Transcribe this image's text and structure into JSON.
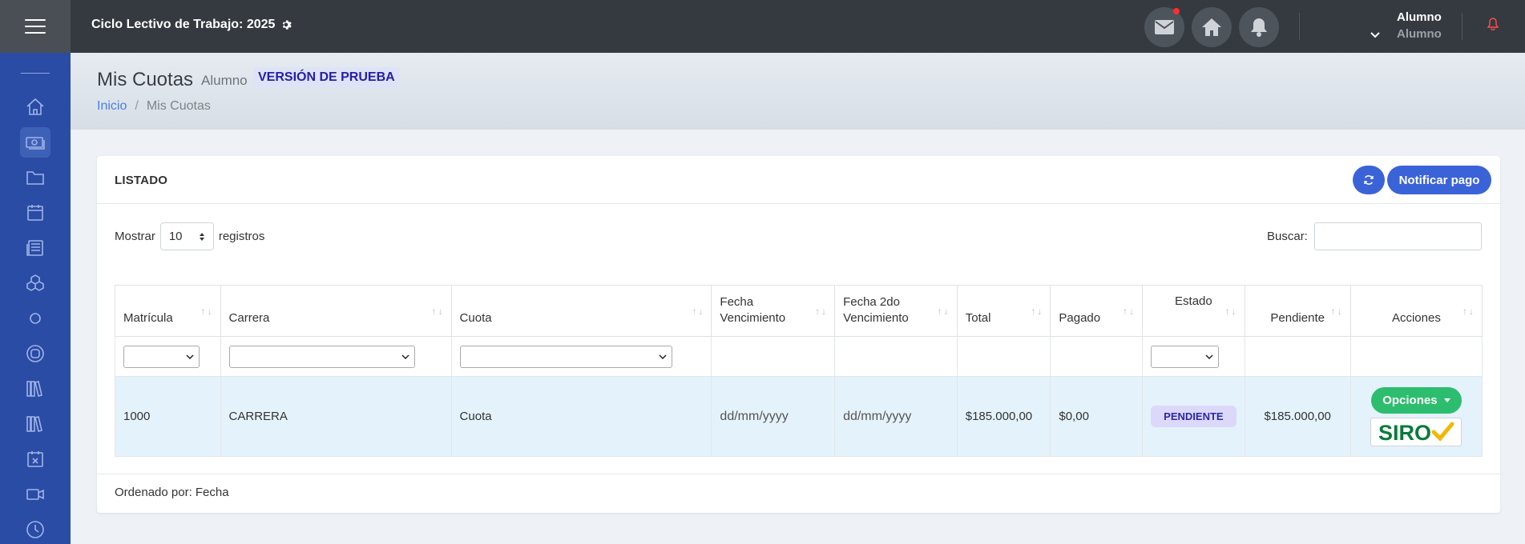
{
  "topbar": {
    "cycle_label": "Ciclo Lectivo de Trabajo: 2025",
    "user_name": "Alumno",
    "user_role": "Alumno"
  },
  "header": {
    "title": "Mis Cuotas",
    "subtitle": "Alumno",
    "trial_badge": "VERSIÓN DE PRUEBA",
    "breadcrumb_home": "Inicio",
    "breadcrumb_sep": "/",
    "breadcrumb_current": "Mis Cuotas"
  },
  "card": {
    "title": "LISTADO",
    "notify_button": "Notificar pago",
    "show_label": "Mostrar",
    "show_value": "10",
    "records_label": "registros",
    "search_label": "Buscar:",
    "search_value": "",
    "footer_note": "Ordenado por: Fecha"
  },
  "table": {
    "headers": {
      "matricula": "Matrícula",
      "carrera": "Carrera",
      "cuota": "Cuota",
      "fecha_venc_1": "Fecha",
      "fecha_venc_2": "Vencimiento",
      "fecha2_1": "Fecha 2do",
      "fecha2_2": "Vencimiento",
      "total": "Total",
      "pagado": "Pagado",
      "estado": "Estado",
      "pendiente": "Pendiente",
      "acciones": "Acciones"
    },
    "rows": [
      {
        "matricula": "1000",
        "carrera": "CARRERA",
        "cuota": "Cuota",
        "fecha_venc": "dd/mm/yyyy",
        "fecha_2do": "dd/mm/yyyy",
        "total": "$185.000,00",
        "pagado": "$0,00",
        "estado": "PENDIENTE",
        "pendiente": "$185.000,00",
        "opciones_label": "Opciones",
        "siro_label": "SIRO"
      }
    ]
  },
  "colors": {
    "sidebar": "#2a4ca5",
    "topbar": "#343a40",
    "primary": "#3b63d8",
    "success": "#2dbd6e"
  }
}
